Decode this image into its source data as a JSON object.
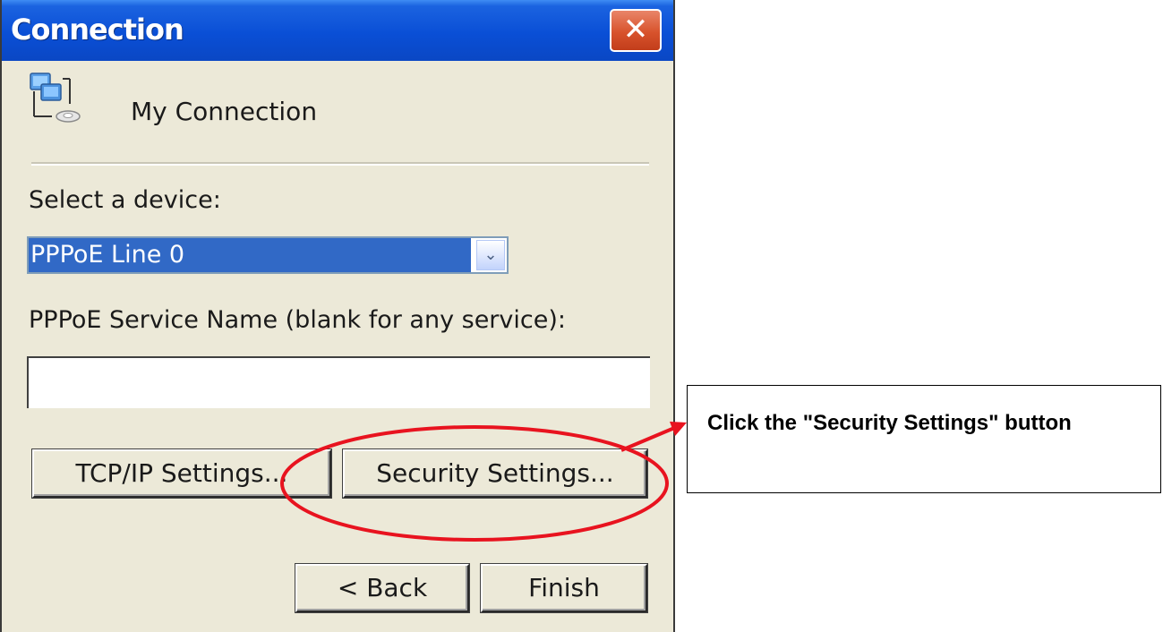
{
  "window": {
    "title": "Connection",
    "close_glyph": "✕",
    "connection_name": "My Connection",
    "icon": "network-computers-icon"
  },
  "device": {
    "label": "Select a device:",
    "selected": "PPPoE Line 0"
  },
  "service": {
    "label": "PPPoE Service Name (blank for any service):",
    "value": ""
  },
  "buttons": {
    "tcpip": "TCP/IP Settings...",
    "security": "Security Settings...",
    "back": "< Back",
    "finish": "Finish"
  },
  "annotation": {
    "text": "Click the \"Security Settings\" button",
    "color": "#e8131f"
  },
  "colors": {
    "titlebar": "#0a4fd6",
    "selection": "#3169c6",
    "window_bg": "#ece9d8",
    "close_button": "#d8532c"
  }
}
